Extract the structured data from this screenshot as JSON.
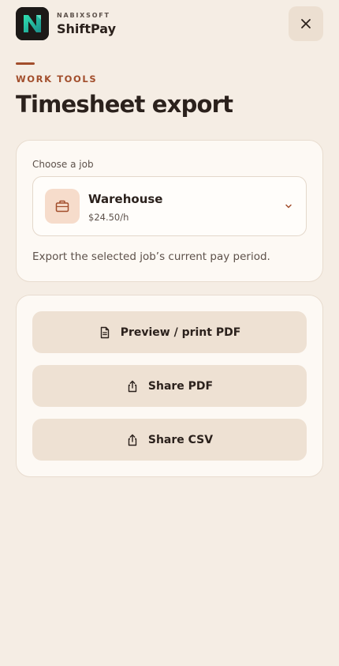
{
  "brand": {
    "company": "NABIXSOFT",
    "app_name": "ShiftPay",
    "logo_letter": "N"
  },
  "header": {
    "close_icon": "close-icon"
  },
  "page": {
    "eyebrow": "WORK TOOLS",
    "title": "Timesheet export"
  },
  "job_picker": {
    "label": "Choose a job",
    "selected_job": "Warehouse",
    "selected_rate": "$24.50/h",
    "icon": "briefcase-icon",
    "help_text": "Export the selected job’s current pay period."
  },
  "actions": [
    {
      "label": "Preview / print PDF",
      "icon": "document-icon"
    },
    {
      "label": "Share PDF",
      "icon": "share-icon"
    },
    {
      "label": "Share CSV",
      "icon": "share-icon"
    }
  ],
  "colors": {
    "background": "#f5ede4",
    "accent": "#a24e2c",
    "card": "#fdf9f4",
    "button": "#eee1d3",
    "logo_gradient_start": "#12c7a0",
    "logo_gradient_end": "#1d8f8a"
  }
}
